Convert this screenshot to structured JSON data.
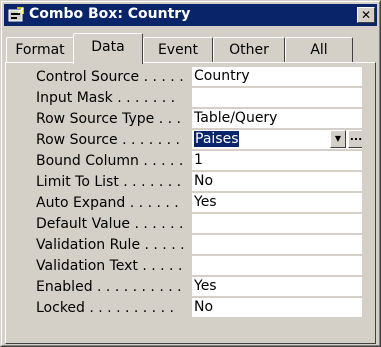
{
  "window": {
    "title": "Combo Box: Country",
    "icon": "combo-box-properties-icon",
    "close_label": "✕"
  },
  "tabs": [
    {
      "label": "Format",
      "active": false
    },
    {
      "label": "Data",
      "active": true
    },
    {
      "label": "Event",
      "active": false
    },
    {
      "label": "Other",
      "active": false
    },
    {
      "label": "All",
      "active": false
    }
  ],
  "properties": [
    {
      "label": "Control Source . . . . .",
      "value": "Country"
    },
    {
      "label": "Input Mask . . . . . . .",
      "value": ""
    },
    {
      "label": "Row Source Type . . .",
      "value": "Table/Query"
    },
    {
      "label": "Row Source . . . . . . .",
      "value": "Paises"
    },
    {
      "label": "Bound Column . . . . .",
      "value": "1"
    },
    {
      "label": "Limit To List . . . . . . .",
      "value": "No"
    },
    {
      "label": "Auto Expand . . . . . .",
      "value": "Yes"
    },
    {
      "label": "Default Value . . . . . .",
      "value": ""
    },
    {
      "label": "Validation Rule . . . . .",
      "value": ""
    },
    {
      "label": "Validation Text . . . . .",
      "value": ""
    },
    {
      "label": "Enabled . . . . . . . . . .",
      "value": "Yes"
    },
    {
      "label": "Locked . . . . . . . . . .",
      "value": "No"
    }
  ],
  "row_source_controls": {
    "dropdown_icon": "dropdown-arrow-icon",
    "builder_icon": "builder-ellipsis-icon",
    "builder_label": "..."
  },
  "colors": {
    "titlebar": "#0a246a",
    "selection": "#0a246a",
    "face": "#d4d0c8"
  }
}
